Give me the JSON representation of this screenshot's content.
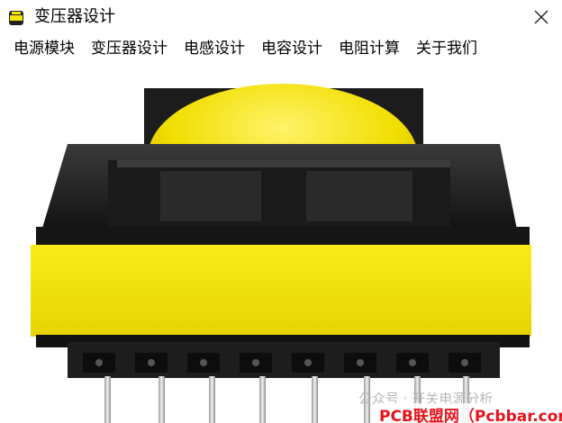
{
  "window": {
    "title": "变压器设计",
    "icon": "transformer-app-icon",
    "close_icon": "close-icon"
  },
  "menu": {
    "items": [
      {
        "label": "电源模块"
      },
      {
        "label": "变压器设计"
      },
      {
        "label": "电感设计"
      },
      {
        "label": "电容设计"
      },
      {
        "label": "电阻计算"
      },
      {
        "label": "关于我们"
      }
    ]
  },
  "image": {
    "subject": "transformer-photo",
    "watermark_brand": "公众号 · 开关电源分析",
    "watermark_site": "PCB联盟网（Pcbbar.com）",
    "colors": {
      "bobbin": "#1a1a1a",
      "tape": "#f4e600",
      "pins": "#cfcfcf"
    }
  }
}
